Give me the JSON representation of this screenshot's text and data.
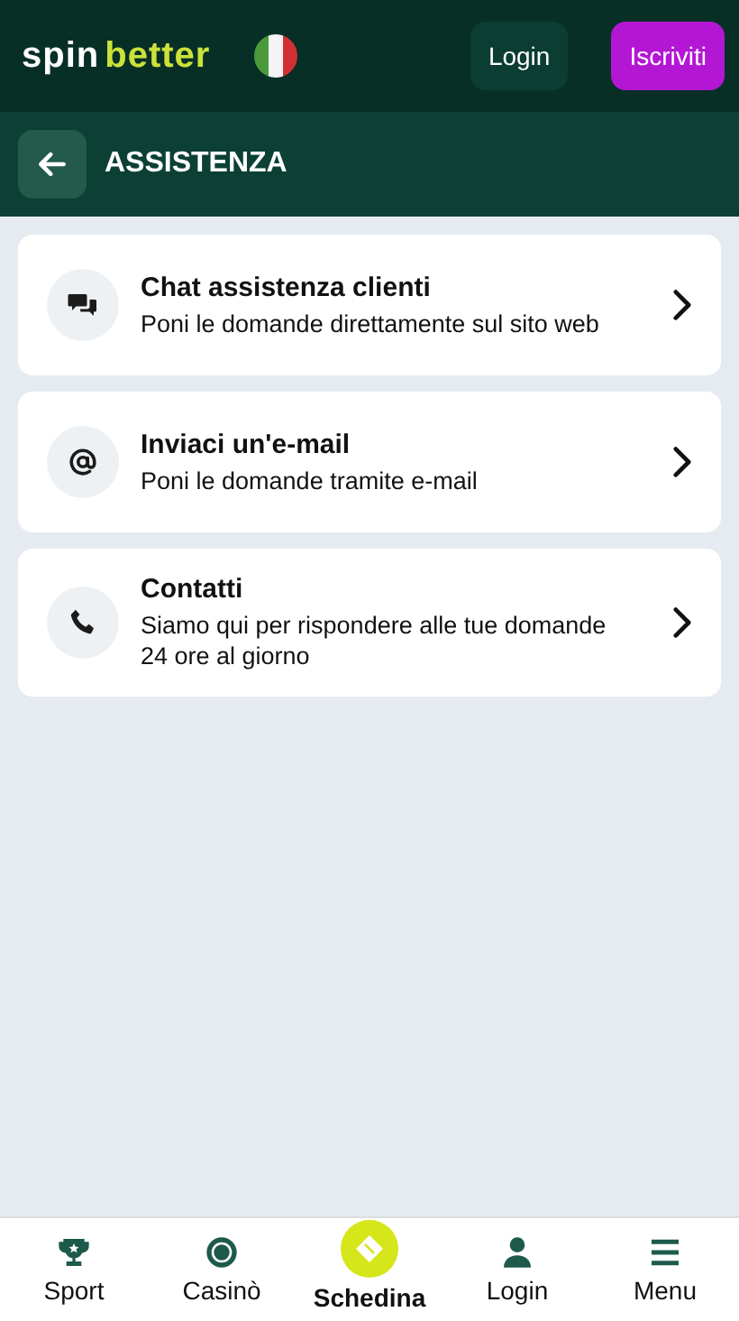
{
  "header": {
    "logo": {
      "first": "spin",
      "second": "better"
    },
    "flag": {
      "kind": "italy"
    },
    "buttons": [
      {
        "label": "Login",
        "kind": "secondary"
      },
      {
        "label": "Iscriviti",
        "kind": "primary"
      }
    ]
  },
  "page": {
    "title": "ASSISTENZA"
  },
  "items": [
    {
      "kind": "chat",
      "title": "Chat assistenza clienti",
      "subtitle": "Poni le domande direttamente sul sito web"
    },
    {
      "kind": "email",
      "title": "Inviaci un'e-mail",
      "subtitle": "Poni le domande tramite e-mail"
    },
    {
      "kind": "phone",
      "title": "Contatti",
      "subtitle": "Siamo qui per rispondere alle tue domande 24 ore al giorno"
    }
  ],
  "nav": [
    {
      "kind": "trophy",
      "label": "Sport",
      "selected": false
    },
    {
      "kind": "chip",
      "label": "Casinò",
      "selected": false
    },
    {
      "kind": "ticket",
      "label": "Schedina",
      "selected": true
    },
    {
      "kind": "user",
      "label": "Login",
      "selected": false
    },
    {
      "kind": "menu",
      "label": "Menu",
      "selected": false
    }
  ]
}
